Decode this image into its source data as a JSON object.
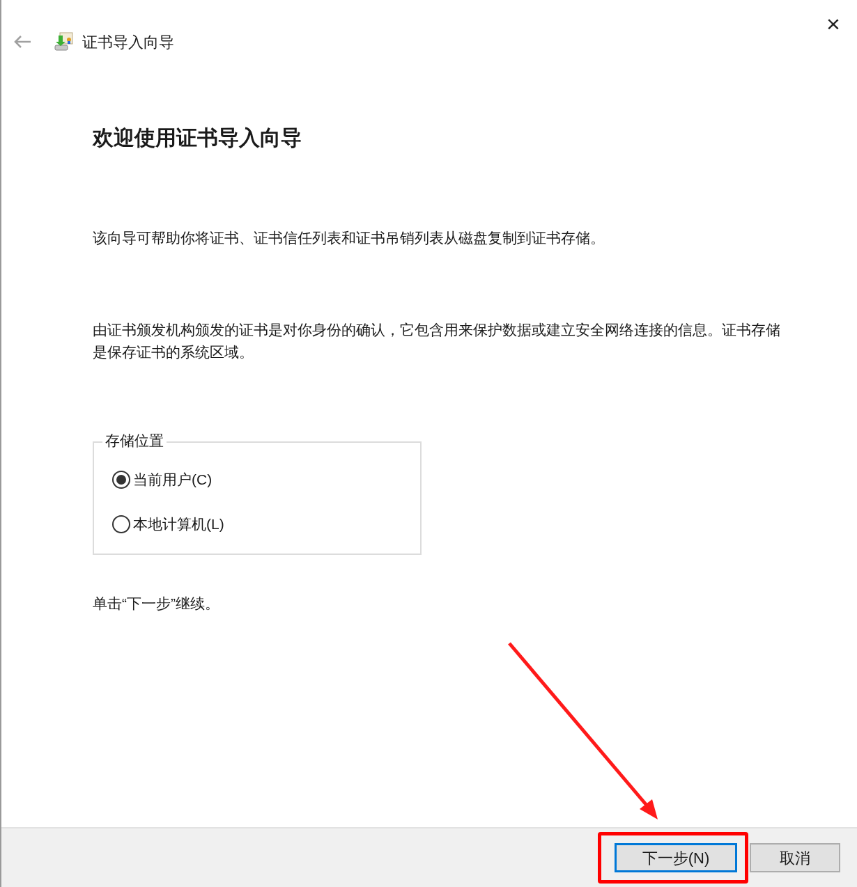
{
  "window": {
    "title": "证书导入向导",
    "close": "×"
  },
  "heading": "欢迎使用证书导入向导",
  "paragraphs": [
    "该向导可帮助你将证书、证书信任列表和证书吊销列表从磁盘复制到证书存储。",
    "由证书颁发机构颁发的证书是对你身份的确认，它包含用来保护数据或建立安全网络连接的信息。证书存储是保存证书的系统区域。"
  ],
  "store_location": {
    "label": "存储位置",
    "options": [
      {
        "label": "当前用户(C)",
        "selected": true
      },
      {
        "label": "本地计算机(L)",
        "selected": false
      }
    ]
  },
  "hint": "单击“下一步”继续。",
  "buttons": [
    {
      "label": "下一步(N)",
      "default": true,
      "highlighted": true
    },
    {
      "label": "取消",
      "default": false,
      "highlighted": false
    }
  ]
}
